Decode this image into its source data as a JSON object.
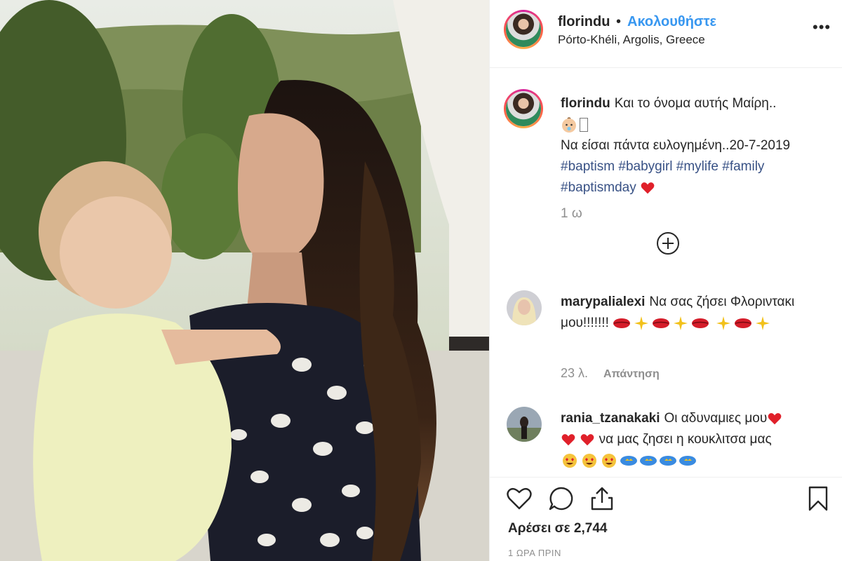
{
  "header": {
    "username": "florindu",
    "separator": "•",
    "follow_label": "Ακολουθήστε",
    "location": "Pórto-Khéli, Argolis, Greece",
    "more_label": "•••"
  },
  "caption": {
    "username": "florindu",
    "line1": "Και το όνομα αυτής Μαίρη..",
    "line2": "Να είσαι πάντα ευλογημένη..20-7-2019",
    "hashtags": [
      "#baptism",
      "#babygirl",
      "#mylife",
      "#family",
      "#baptismday"
    ],
    "time": "1 ω"
  },
  "comments": [
    {
      "username": "marypalialexi",
      "text": "Να σας ζήσει Φλοριντακι μου!!!!!!!",
      "likes": "23 λ.",
      "reply_label": "Απάντηση"
    },
    {
      "username": "rania_tzanakaki",
      "text1": "Οι αδυναμιες μου",
      "text2": "να μας ζησει η κουκλιτσα μας"
    }
  ],
  "actions": {
    "likes_text": "Αρέσει σε 2,744",
    "timestamp": "1 ΩΡΑ ΠΡΙΝ"
  },
  "icons": {
    "more": "more-dots-icon",
    "add_comment": "plus-circle-icon",
    "like": "heart-outline-icon",
    "comment": "speech-bubble-icon",
    "share": "share-upload-icon",
    "save": "bookmark-icon"
  },
  "colors": {
    "follow": "#3897f0",
    "hashtag": "#385185",
    "muted": "#8e8e8e",
    "heart_emoji": "#e0202a"
  }
}
